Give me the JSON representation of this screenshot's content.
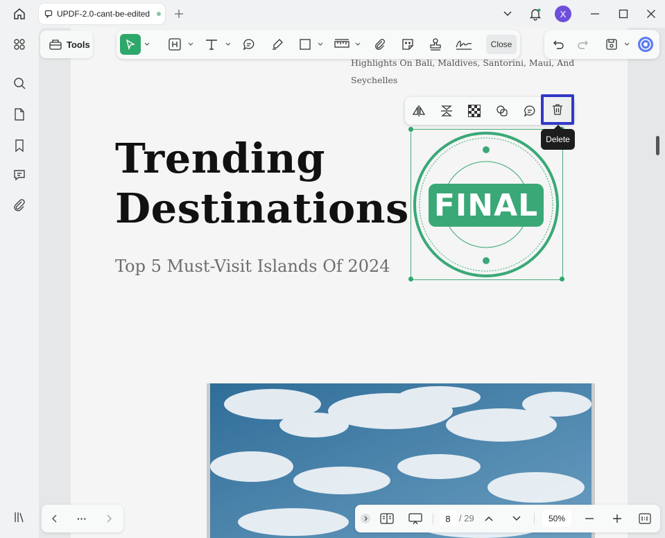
{
  "window": {
    "tab_title": "UPDF-2.0-cant-be-edited",
    "avatar_letter": "X"
  },
  "toolbar": {
    "tools_label": "Tools",
    "close_label": "Close"
  },
  "page": {
    "highlights_line1": "Highlights On Bali, Maldives, Santorini, Maui, And",
    "highlights_line2": "Seychelles",
    "headline_line1": "Trending",
    "headline_line2": "Destinations",
    "subtitle": "Top 5 Must-Visit Islands Of 2024"
  },
  "stamp": {
    "text": "FINAL",
    "color": "#3aa877"
  },
  "context_toolbar": {
    "tooltip": "Delete",
    "highlight_color": "#3139c6"
  },
  "pagination": {
    "current_page": "8",
    "total_pages": "/ 29",
    "zoom": "50%",
    "more_label": "···"
  },
  "colors": {
    "accent": "#2ea86a"
  }
}
